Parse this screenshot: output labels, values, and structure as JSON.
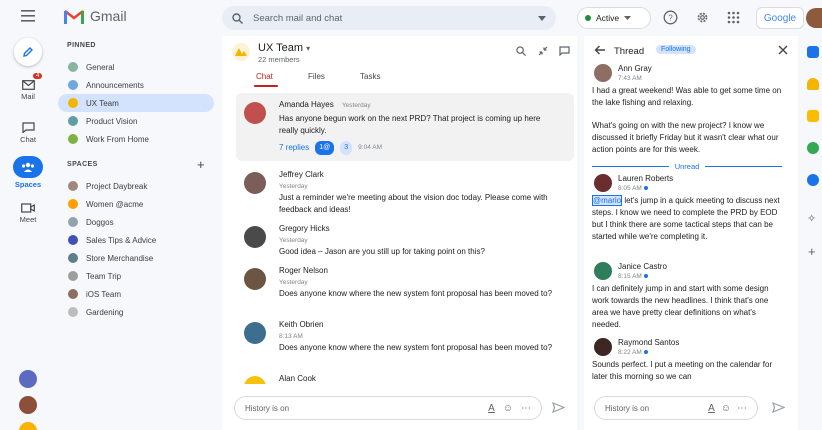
{
  "app": {
    "name": "Gmail"
  },
  "search": {
    "placeholder": "Search mail and chat"
  },
  "status": {
    "label": "Active",
    "color": "#1e8e3e"
  },
  "google_label": "Google",
  "rail": {
    "mail": {
      "label": "Mail",
      "badge": "4"
    },
    "chat": {
      "label": "Chat"
    },
    "spaces": {
      "label": "Spaces"
    },
    "meet": {
      "label": "Meet"
    }
  },
  "sidebar": {
    "pinned_header": "PINNED",
    "pinned": [
      {
        "label": "General",
        "color": "#8ab4a0"
      },
      {
        "label": "Announcements",
        "color": "#6fa8dc"
      },
      {
        "label": "UX Team",
        "color": "#f4b400"
      },
      {
        "label": "Product Vision",
        "color": "#5f9ea0"
      },
      {
        "label": "Work From Home",
        "color": "#7cb342"
      }
    ],
    "spaces_header": "SPACES",
    "spaces": [
      {
        "label": "Project Daybreak",
        "color": "#a1887f"
      },
      {
        "label": "Women @acme",
        "color": "#ffa000"
      },
      {
        "label": "Doggos",
        "color": "#90a4ae"
      },
      {
        "label": "Sales Tips & Advice",
        "color": "#3f51b5"
      },
      {
        "label": "Store Merchandise",
        "color": "#607d8b"
      },
      {
        "label": "Team Trip",
        "color": "#9e9e9e"
      },
      {
        "label": "iOS Team",
        "color": "#8d6e63"
      },
      {
        "label": "Gardening",
        "color": "#bdbdbd"
      }
    ]
  },
  "room": {
    "title": "UX Team",
    "members": "22 members",
    "tabs": [
      "Chat",
      "Files",
      "Tasks"
    ]
  },
  "messages": [
    {
      "name": "Amanda Hayes",
      "time": "Yesterday",
      "text": "Has anyone begun work on the next PRD? That project is coming up here really quickly.",
      "replies": "7 replies",
      "pill1": "1@",
      "pill2": "3",
      "reply_time": "9:04 AM",
      "color": "#c0504d"
    },
    {
      "name": "Jeffrey Clark",
      "time": "Yesterday",
      "text": "Just a reminder we're meeting about the vision doc today. Please come with feedback and ideas!",
      "color": "#7b5e57"
    },
    {
      "name": "Gregory Hicks",
      "time": "Yesterday",
      "text": "Good idea – Jason are you still up for taking point on this?",
      "color": "#4a4a4a"
    },
    {
      "name": "Roger Nelson",
      "time": "Yesterday",
      "text": "Does anyone know where the new system font proposal has been moved to?",
      "color": "#6d5544"
    },
    {
      "name": "Keith Obrien",
      "time": "8:13 AM",
      "text": "Does anyone know where the new system font proposal has been moved to?",
      "color": "#3c6e8f"
    },
    {
      "name": "Alan Cook",
      "color": "#f4c20d"
    }
  ],
  "compose": {
    "placeholder": "History is on"
  },
  "thread": {
    "title": "Thread",
    "badge": "Following",
    "unread_label": "Unread",
    "messages": [
      {
        "name": "Ann Gray",
        "time": "7:43 AM",
        "text": "I had a great weekend! Was able to get some time on the lake fishing and relaxing.",
        "color": "#8d6e63"
      },
      {
        "text": "What's going on with the new project? I know we discussed it briefly Friday but it wasn't clear what our action points are for this week."
      },
      {
        "name": "Lauren Roberts",
        "time": "8:05 AM",
        "mention": "@mario",
        "text": " let's jump in a quick meeting to discuss next steps. I know we need to complete the PRD by EOD but I think there are some tactical steps that can be started while we're completing it.",
        "color": "#6b2e2e"
      },
      {
        "name": "Janice Castro",
        "time": "8:15 AM",
        "text": "I can definitely jump in and start with some design work towards the new headlines. I think that's one area we have pretty clear definitions on what's needed.",
        "color": "#2e7d5b"
      },
      {
        "name": "Raymond Santos",
        "time": "8:22 AM",
        "text": "Sounds perfect. I put a meeting on the calendar for later this morning so we can",
        "color": "#3e2723"
      }
    ],
    "compose_placeholder": "History is on"
  }
}
